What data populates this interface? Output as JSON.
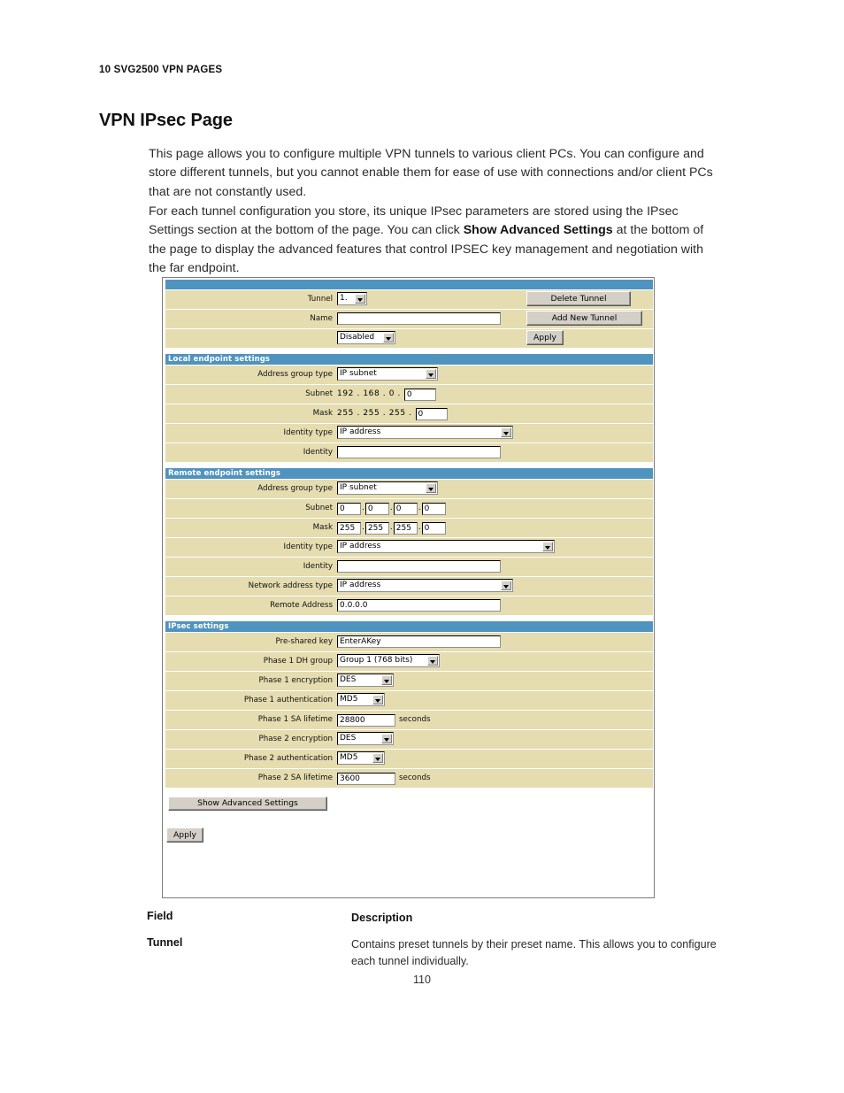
{
  "document": {
    "running_head": "10 SVG2500 VPN PAGES",
    "title": "VPN IPsec Page",
    "paragraph_1": "This page allows you to configure multiple VPN tunnels to various client PCs. You can configure and store different tunnels, but you cannot enable them for ease of use with connections and/or client PCs that are not constantly used.",
    "paragraph_2_pre": "For each tunnel configuration you store, its unique IPsec parameters are stored using the IPsec Settings section at the bottom of the page. You can click ",
    "paragraph_2_bold": "Show Advanced Settings",
    "paragraph_2_post": " at the bottom of the page to display the advanced features that control IPSEC key management and negotiation with the far endpoint.",
    "field_table": {
      "header_field": "Field",
      "header_description": "Description",
      "rows": [
        {
          "field": "Tunnel",
          "description": "Contains preset tunnels by their preset name. This allows you to configure each tunnel individually."
        }
      ]
    },
    "page_number": "110"
  },
  "colors": {
    "band_blue": "#4f93bf",
    "row_tan": "#e5dcb0",
    "button_face": "#d4d0c8",
    "panel_border": "#7c7c7c"
  },
  "screenshot": {
    "tunnel_section": {
      "band_label": "",
      "rows": {
        "tunnel": {
          "label": "Tunnel",
          "select_value": "1.",
          "action_button": "Delete Tunnel"
        },
        "name": {
          "label": "Name",
          "input_value": "",
          "action_button": "Add New Tunnel"
        },
        "enable": {
          "label": "",
          "select_value": "Disabled",
          "action_button": "Apply"
        }
      }
    },
    "local_endpoint": {
      "band_label": "Local endpoint settings",
      "address_group_type": {
        "label": "Address group type",
        "select_value": "IP subnet"
      },
      "subnet": {
        "label": "Subnet",
        "prefix": "192 . 168 . 0 .",
        "input_value": "0"
      },
      "mask": {
        "label": "Mask",
        "prefix": "255 . 255 . 255 .",
        "input_value": "0"
      },
      "identity_type": {
        "label": "Identity type",
        "select_value": "IP address"
      },
      "identity": {
        "label": "Identity",
        "input_value": ""
      }
    },
    "remote_endpoint": {
      "band_label": "Remote endpoint settings",
      "address_group_type": {
        "label": "Address group type",
        "select_value": "IP subnet"
      },
      "subnet": {
        "label": "Subnet",
        "octets": [
          "0",
          "0",
          "0",
          "0"
        ]
      },
      "mask": {
        "label": "Mask",
        "octets": [
          "255",
          "255",
          "255",
          "0"
        ]
      },
      "identity_type": {
        "label": "Identity type",
        "select_value": "IP address"
      },
      "identity": {
        "label": "Identity",
        "input_value": ""
      },
      "network_address_type": {
        "label": "Network address type",
        "select_value": "IP address"
      },
      "remote_address": {
        "label": "Remote Address",
        "input_value": "0.0.0.0"
      }
    },
    "ipsec_settings": {
      "band_label": "IPsec settings",
      "pre_shared_key": {
        "label": "Pre-shared key",
        "input_value": "EnterAKey"
      },
      "phase1_dh_group": {
        "label": "Phase 1 DH group",
        "select_value": "Group 1 (768 bits)"
      },
      "phase1_encryption": {
        "label": "Phase 1 encryption",
        "select_value": "DES"
      },
      "phase1_authentication": {
        "label": "Phase 1 authentication",
        "select_value": "MD5"
      },
      "phase1_sa_lifetime": {
        "label": "Phase 1 SA lifetime",
        "input_value": "28800",
        "units": "seconds"
      },
      "phase2_encryption": {
        "label": "Phase 2 encryption",
        "select_value": "DES"
      },
      "phase2_authentication": {
        "label": "Phase 2 authentication",
        "select_value": "MD5"
      },
      "phase2_sa_lifetime": {
        "label": "Phase 2 SA lifetime",
        "input_value": "3600",
        "units": "seconds"
      }
    },
    "footer": {
      "show_advanced_button": "Show Advanced Settings",
      "apply_button": "Apply"
    }
  }
}
